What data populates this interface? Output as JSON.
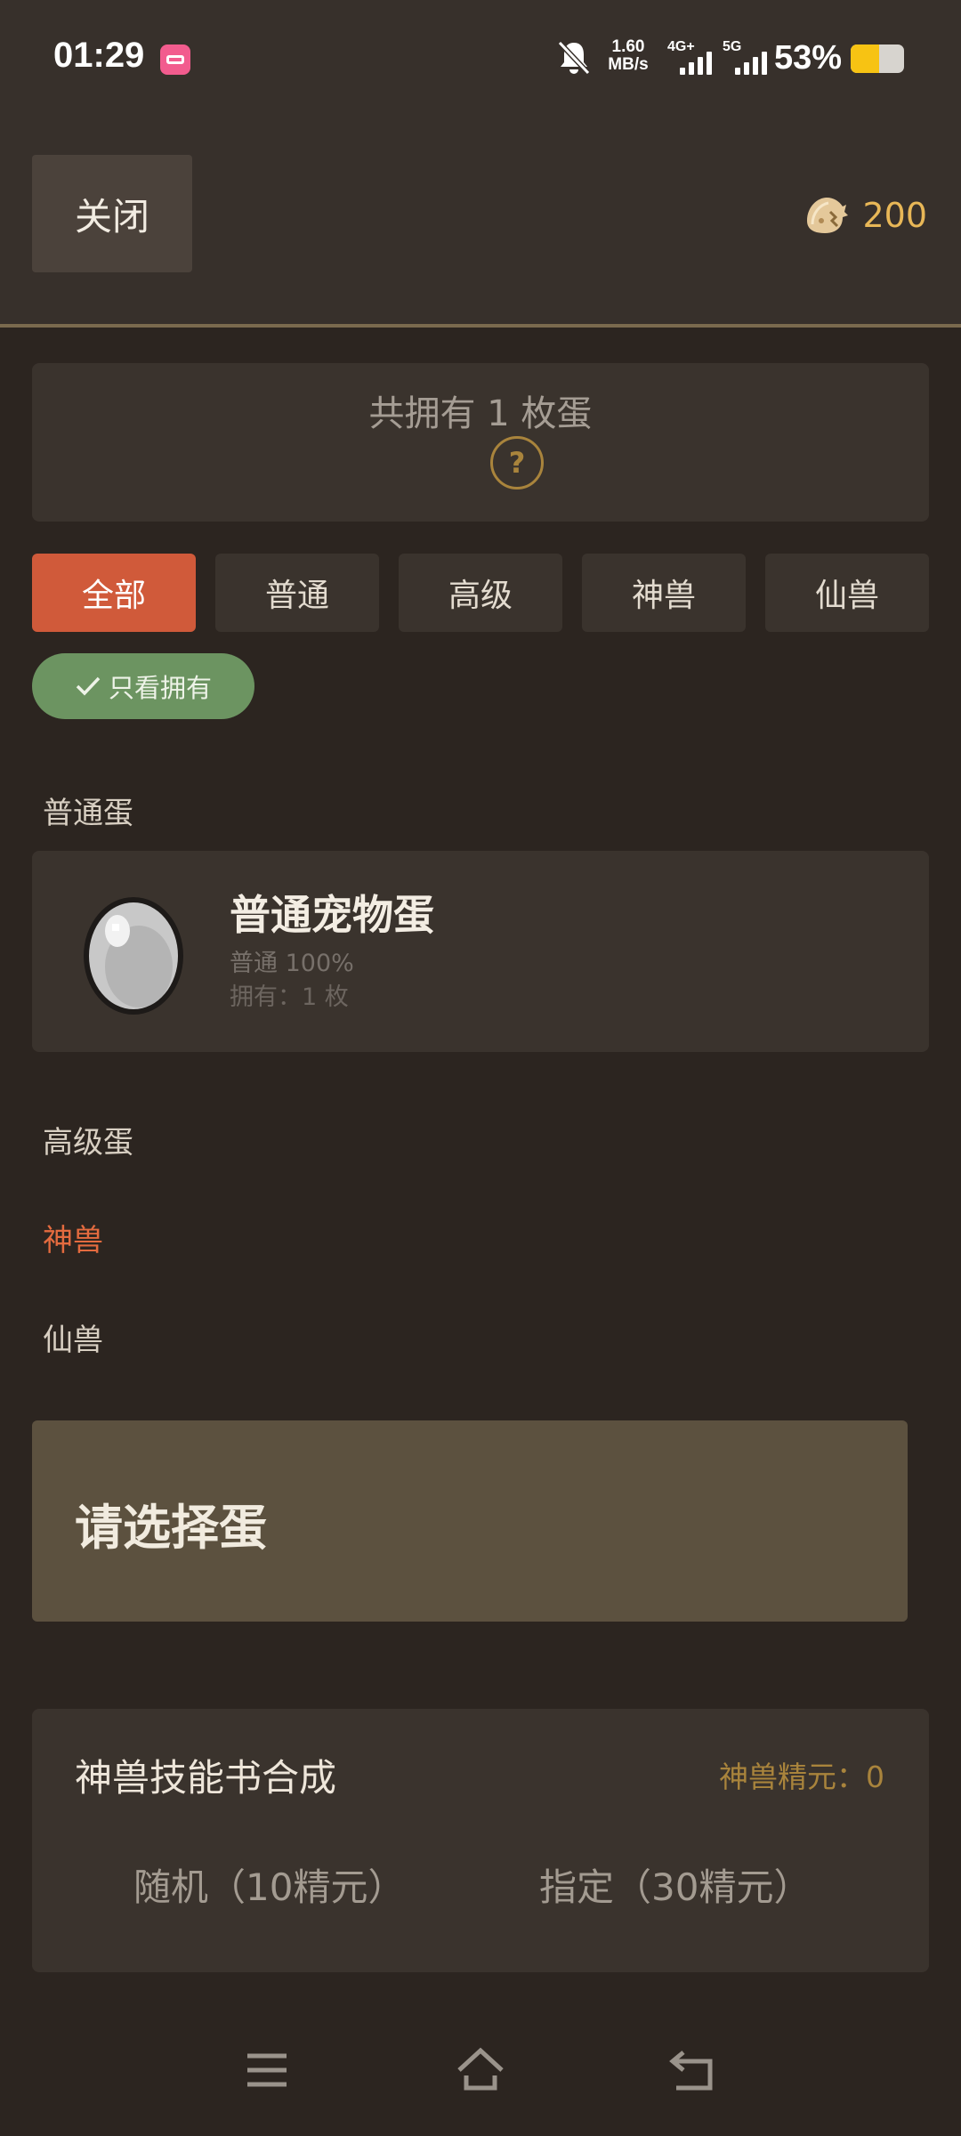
{
  "status_bar": {
    "time": "01:29",
    "net_speed_value": "1.60",
    "net_speed_unit": "MB/s",
    "signal_1_label": "4G+",
    "signal_2_label": "5G",
    "battery_percent": "53%",
    "battery_level": 0.53,
    "app_icon": "bilibili-icon",
    "mute_icon": "bell-off-icon"
  },
  "header": {
    "close_label": "关闭",
    "currency_icon": "cracked-egg-icon",
    "currency_value": "200"
  },
  "summary": {
    "total_text": "共拥有 1 枚蛋",
    "help_symbol": "?"
  },
  "tabs": [
    {
      "label": "全部",
      "active": true
    },
    {
      "label": "普通",
      "active": false
    },
    {
      "label": "高级",
      "active": false
    },
    {
      "label": "神兽",
      "active": false
    },
    {
      "label": "仙兽",
      "active": false
    }
  ],
  "filter": {
    "label": "只看拥有",
    "checked": true
  },
  "sections": {
    "normal": "普通蛋",
    "advanced": "高级蛋",
    "divine": "神兽",
    "immortal": "仙兽"
  },
  "egg_card": {
    "name": "普通宠物蛋",
    "rate": "普通 100%",
    "owned": "拥有：1 枚"
  },
  "select_prompt": "请选择蛋",
  "skill_panel": {
    "title": "神兽技能书合成",
    "essence": "神兽精元：0",
    "random_option": "随机（10精元）",
    "specified_option": "指定（30精元）"
  },
  "colors": {
    "background": "#2c2520",
    "panel": "#3a332d",
    "active_tab": "#d05a3a",
    "filter_green": "#6c9461",
    "gold": "#e8b757",
    "accent_orange": "#e46b3f"
  }
}
